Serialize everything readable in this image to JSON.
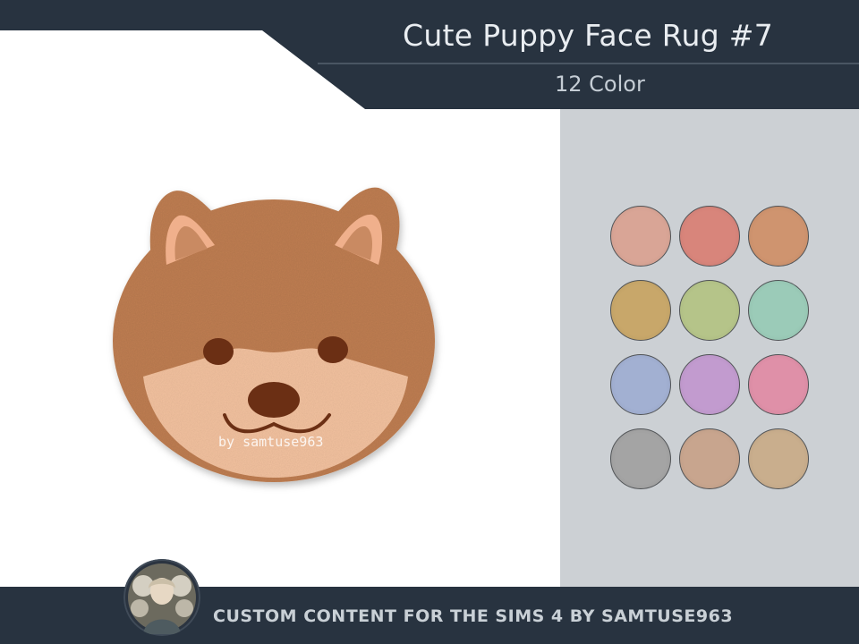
{
  "header": {
    "title": "Cute Puppy Face Rug #7",
    "subtitle": "12 Color",
    "bg_color": "#283340",
    "line_color": "#6c7886"
  },
  "product": {
    "watermark": "by samtuse963",
    "fur_color": "#c07f52",
    "muzzle_color": "#f4c3a0",
    "feature_color": "#6b2f14"
  },
  "swatches": {
    "panel_color": "#ccd0d4",
    "colors": [
      "#d9a596",
      "#d8857b",
      "#cf946f",
      "#c8a76a",
      "#b5c489",
      "#9bcbb8",
      "#a2b0d2",
      "#c29bcf",
      "#df90a8",
      "#a4a4a4",
      "#c8a58e",
      "#c9ae8d"
    ]
  },
  "footer": {
    "text": "CUSTOM CONTENT FOR THE SIMS 4 BY SAMTUSE963",
    "avatar_icon": "doll-portrait-icon"
  }
}
